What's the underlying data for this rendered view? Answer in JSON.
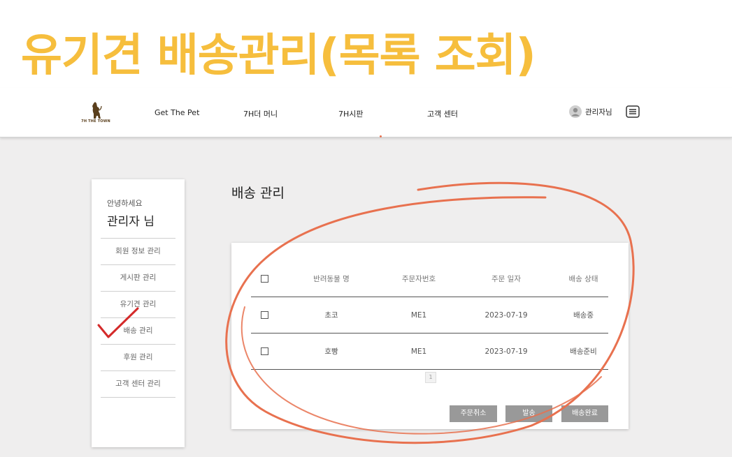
{
  "slide_title": "유기견 배송관리(목록 조회)",
  "brand": {
    "logo_text": "7H THE TOWN"
  },
  "nav": {
    "links": [
      "Get The Pet",
      "7H더 머니",
      "7H시판",
      "고객 센터"
    ],
    "user_label": "관리자님"
  },
  "sidebar": {
    "greeting": "안녕하세요",
    "admin_name": "관리자 님",
    "items": [
      "회원 정보 관리",
      "게시판 관리",
      "유기견 관리",
      "배송 관리",
      "후원 관리",
      "고객 센터 관리"
    ]
  },
  "section_title": "배송 관리",
  "table": {
    "headers": [
      "반려동물 명",
      "주문자번호",
      "주문 일자",
      "배송 상태"
    ],
    "rows": [
      {
        "pet_name": "초코",
        "orderer_no": "ME1",
        "order_date": "2023-07-19",
        "status": "배송중"
      },
      {
        "pet_name": "호빵",
        "orderer_no": "ME1",
        "order_date": "2023-07-19",
        "status": "배송준비"
      }
    ]
  },
  "pagination": {
    "current_page": "1"
  },
  "buttons": {
    "cancel_order": "주문취소",
    "ship": "발송",
    "delivery_complete": "배송완료"
  },
  "colors": {
    "title_yellow": "#f6be3d",
    "annotation_orange": "#e8714f",
    "checkmark_red": "#d42a2a",
    "button_gray": "#999999",
    "background": "#efeeee"
  },
  "icons": {
    "logo": "dog-silhouette-icon",
    "user": "user-avatar-icon",
    "menu": "hamburger-menu-icon",
    "annotation_circle": "highlight-ellipse",
    "annotation_check": "checkmark-icon"
  }
}
